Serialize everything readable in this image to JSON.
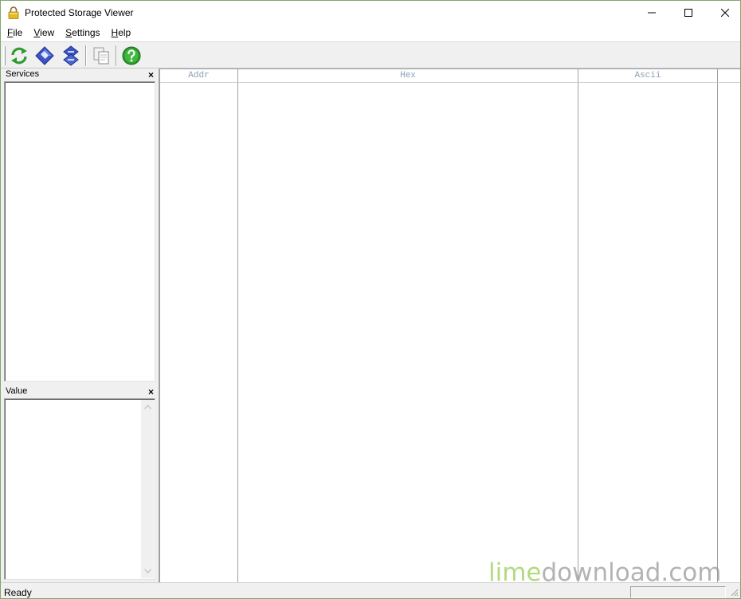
{
  "window": {
    "title": "Protected Storage Viewer",
    "icon": "padlock-icon"
  },
  "menu": {
    "items": [
      {
        "accel": "F",
        "rest": "ile"
      },
      {
        "accel": "V",
        "rest": "iew"
      },
      {
        "accel": "S",
        "rest": "ettings"
      },
      {
        "accel": "H",
        "rest": "elp"
      }
    ]
  },
  "toolbar": {
    "buttons": [
      "refresh-icon",
      "export-icon",
      "sort-icon",
      "copy-icon",
      "help-icon"
    ]
  },
  "services_pane": {
    "title": "Services",
    "close": "×"
  },
  "value_pane": {
    "title": "Value",
    "close": "×"
  },
  "hex_view": {
    "columns": [
      "Addr",
      "Hex",
      "Ascii"
    ]
  },
  "status": {
    "text": "Ready"
  },
  "watermark": {
    "brand": "lime",
    "rest": "download.com"
  },
  "colors": {
    "header_text": "#8a9fb5",
    "watermark_lime": "#a6d46a",
    "toolbar_green": "#2f9b2f",
    "toolbar_blue": "#3b55c8"
  }
}
